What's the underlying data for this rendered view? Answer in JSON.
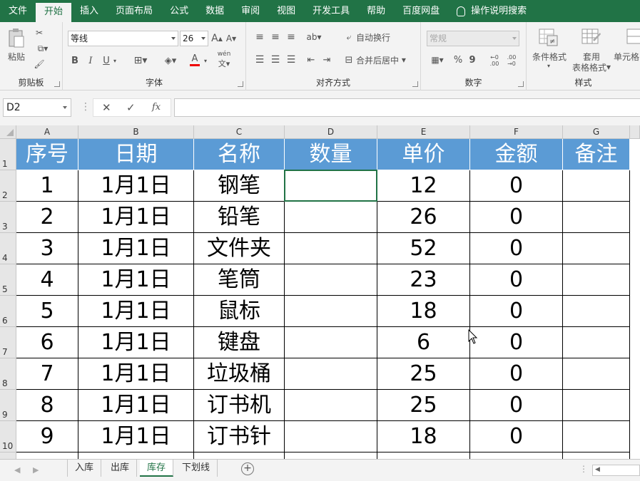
{
  "ribbon_tabs": [
    "文件",
    "开始",
    "插入",
    "页面布局",
    "公式",
    "数据",
    "审阅",
    "视图",
    "开发工具",
    "帮助",
    "百度网盘"
  ],
  "active_tab_index": 1,
  "tell_me": "操作说明搜索",
  "groups": {
    "clipboard": {
      "paste": "粘贴",
      "label": "剪贴板"
    },
    "font": {
      "name": "等线",
      "size": "26",
      "bold": "B",
      "italic": "I",
      "underline": "U",
      "grow": "A",
      "shrink": "A",
      "font_color_glyph": "A",
      "pinyin": "wén",
      "label": "字体"
    },
    "alignment": {
      "wrap": "自动换行",
      "merge": "合并后居中",
      "label": "对齐方式"
    },
    "number": {
      "format": "常规",
      "percent": "%",
      "comma": "9",
      "inc_decimal": "←0 .00",
      "dec_decimal": ".00 →0",
      "label": "数字"
    },
    "styles": {
      "conditional": "条件格式",
      "table_1": "套用",
      "table_2": "表格格式",
      "cell_styles": "单元格",
      "label": "样式"
    }
  },
  "formula_bar": {
    "name_box": "D2",
    "cancel": "✕",
    "enter": "✓",
    "fx": "fx",
    "value": ""
  },
  "columns": [
    "A",
    "B",
    "C",
    "D",
    "E",
    "F",
    "G"
  ],
  "row_numbers": [
    "1",
    "2",
    "3",
    "4",
    "5",
    "6",
    "7",
    "8",
    "9",
    "10"
  ],
  "table": {
    "headers": [
      "序号",
      "日期",
      "名称",
      "数量",
      "单价",
      "金额",
      "备注"
    ],
    "rows": [
      [
        "1",
        "1月1日",
        "钢笔",
        "",
        "12",
        "0",
        ""
      ],
      [
        "2",
        "1月1日",
        "铅笔",
        "",
        "26",
        "0",
        ""
      ],
      [
        "3",
        "1月1日",
        "文件夹",
        "",
        "52",
        "0",
        ""
      ],
      [
        "4",
        "1月1日",
        "笔筒",
        "",
        "23",
        "0",
        ""
      ],
      [
        "5",
        "1月1日",
        "鼠标",
        "",
        "18",
        "0",
        ""
      ],
      [
        "6",
        "1月1日",
        "键盘",
        "",
        "6",
        "0",
        ""
      ],
      [
        "7",
        "1月1日",
        "垃圾桶",
        "",
        "25",
        "0",
        ""
      ],
      [
        "8",
        "1月1日",
        "订书机",
        "",
        "25",
        "0",
        ""
      ],
      [
        "9",
        "1月1日",
        "订书针",
        "",
        "18",
        "0",
        ""
      ]
    ]
  },
  "selected_cell": "D2",
  "sheets": [
    "入库",
    "出库",
    "库存",
    "下划线"
  ],
  "active_sheet_index": 2,
  "colors": {
    "accent": "#217346",
    "header_fill": "#5b9bd5"
  }
}
